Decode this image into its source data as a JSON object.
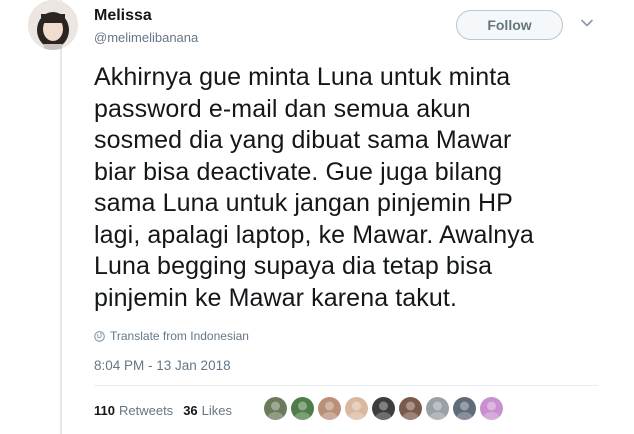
{
  "author": {
    "display_name": "Melissa",
    "handle": "@melimelibanana"
  },
  "follow_label": "Follow",
  "tweet": {
    "text": "Akhirnya gue minta Luna untuk minta\npassword e-mail dan semua akun\nsosmed dia yang dibuat sama Mawar\nbiar bisa deactivate. Gue juga bilang\nsama Luna untuk jangan pinjemin HP\nlagi, apalagi laptop, ke Mawar. Awalnya\nLuna begging supaya dia tetap bisa\npinjemin ke Mawar karena takut.",
    "translate_label": "Translate from Indonesian",
    "timestamp": "8:04 PM - 13 Jan 2018"
  },
  "stats": {
    "retweets_count": "110",
    "retweets_label": "Retweets",
    "likes_count": "36",
    "likes_label": "Likes"
  },
  "likers": [
    {
      "name": "liker-avatar-1",
      "color": "#6b7a5a"
    },
    {
      "name": "liker-avatar-2",
      "color": "#4f7d4a"
    },
    {
      "name": "liker-avatar-3",
      "color": "#b89078"
    },
    {
      "name": "liker-avatar-4",
      "color": "#d9b8a0"
    },
    {
      "name": "liker-avatar-5",
      "color": "#3d3d3d"
    },
    {
      "name": "liker-avatar-6",
      "color": "#7a5a4a"
    },
    {
      "name": "liker-avatar-7",
      "color": "#9aa0a6"
    },
    {
      "name": "liker-avatar-8",
      "color": "#5f6b78"
    },
    {
      "name": "liker-avatar-9",
      "color": "#c98fcf"
    }
  ]
}
